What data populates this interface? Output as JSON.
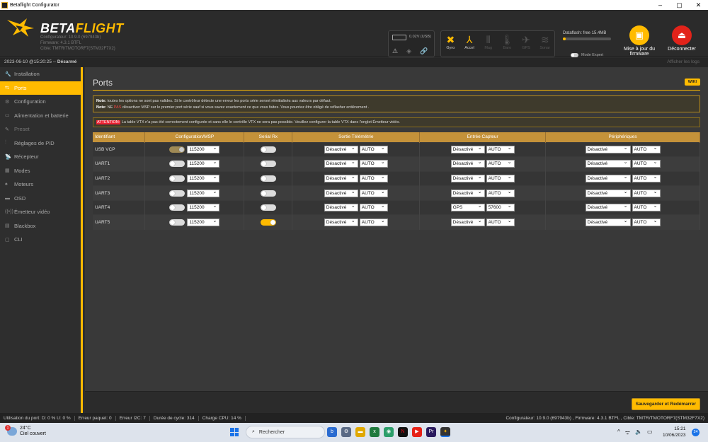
{
  "window": {
    "title": "Betaflight Configurator",
    "min": "–",
    "max": "▢",
    "close": "✕"
  },
  "header": {
    "brand_beta": "BETA",
    "brand_flight": "FLIGHT",
    "version_lines": [
      "Configurateur: 10.9.0 (697943b)",
      "Firmware: 4.3.1 BTFL",
      "Cible: TMTR/TMOTORF7(STM32F7X2)"
    ],
    "battery": "0.02V (USB)",
    "sensors": [
      {
        "icon": "gyro-icon",
        "glyph": "✖",
        "label": "Gyro",
        "active": true
      },
      {
        "icon": "accel-icon",
        "glyph": "⅄",
        "label": "Accel",
        "active": true
      },
      {
        "icon": "mag-icon",
        "glyph": "⫴",
        "label": "Mag",
        "active": false
      },
      {
        "icon": "baro-icon",
        "glyph": "🌡",
        "label": "Baro",
        "active": false
      },
      {
        "icon": "gps-icon",
        "glyph": "✈",
        "label": "GPS",
        "active": false
      },
      {
        "icon": "sonar-icon",
        "glyph": "≋",
        "label": "Sonar",
        "active": false
      }
    ],
    "dataflash_label": "Dataflash: free 15.4MB",
    "dataflash_used": 0.06,
    "expert_mode": "Mode Expert",
    "update_label": "Mise à jour du firmware",
    "disconnect_label": "Déconnecter"
  },
  "statusline": {
    "datetime": "2023-06-10 @15:20:25 -- ",
    "armed": "Désarmé",
    "logs": "Afficher les logs"
  },
  "sidebar": [
    {
      "icon": "wrench-icon",
      "glyph": "🔧",
      "label": "Installation",
      "active": false
    },
    {
      "icon": "ports-icon",
      "glyph": "⇆",
      "label": "Ports",
      "active": true
    },
    {
      "icon": "gear-icon",
      "glyph": "⚙",
      "label": "Configuration",
      "active": false
    },
    {
      "icon": "battery-icon",
      "glyph": "▭",
      "label": "Alimentation et batterie",
      "active": false
    },
    {
      "icon": "preset-icon",
      "glyph": "✎",
      "label": "Preset",
      "active": false,
      "dim": true
    },
    {
      "icon": "pid-icon",
      "glyph": "⫶",
      "label": "Réglages de PID",
      "active": false
    },
    {
      "icon": "receiver-icon",
      "glyph": "📡",
      "label": "Récepteur",
      "active": false
    },
    {
      "icon": "modes-icon",
      "glyph": "▦",
      "label": "Modes",
      "active": false
    },
    {
      "icon": "motors-icon",
      "glyph": "♠",
      "label": "Moteurs",
      "active": false
    },
    {
      "icon": "osd-icon",
      "glyph": "▬",
      "label": "OSD",
      "active": false
    },
    {
      "icon": "vtx-icon",
      "glyph": "((•))",
      "label": "Émetteur vidéo",
      "active": false
    },
    {
      "icon": "blackbox-icon",
      "glyph": "▤",
      "label": "Blackbox",
      "active": false
    },
    {
      "icon": "cli-icon",
      "glyph": "▢",
      "label": "CLI",
      "active": false
    }
  ],
  "content": {
    "title": "Ports",
    "wiki": "WIKI",
    "note1_b": "Note:",
    "note1": " toutes les options ne sont pas valides. Si le contrôleur détecte une erreur les ports série seront réinitialisés aux valeurs par défaut.",
    "note2_b": "Note:",
    "note2_a": " NE ",
    "note2_pas": "PAS",
    "note2_c": " désactiver MSP sur le premier port série sauf si vous savez exactement ce que vous faites. Vous pourriez être obligé de reflasher entièrement .",
    "warn_att": "ATTENTION:",
    "warn": " La table VTX n'a pas été correctement configurée et sans elle le contrôle VTX ne sera pas possible. Veuillez configurer la table VTX dans l'onglet Émetteur vidéo.",
    "headers": [
      "Identifiant",
      "Configuration/MSP",
      "Serial Rx",
      "Sortie Télémétrie",
      "Entrée Capteur",
      "Périphériques"
    ],
    "rows": [
      {
        "id": "USB VCP",
        "msp": "dis",
        "baud": "115200",
        "rx": false,
        "tel": "Désactivé",
        "tel_b": "AUTO",
        "sen": "Désactivé",
        "sen_b": "AUTO",
        "per": "Désactivé",
        "per_b": "AUTO"
      },
      {
        "id": "UART1",
        "msp": "off",
        "baud": "115200",
        "rx": false,
        "tel": "Désactivé",
        "tel_b": "AUTO",
        "sen": "Désactivé",
        "sen_b": "AUTO",
        "per": "Désactivé",
        "per_b": "AUTO"
      },
      {
        "id": "UART2",
        "msp": "off",
        "baud": "115200",
        "rx": false,
        "tel": "Désactivé",
        "tel_b": "AUTO",
        "sen": "Désactivé",
        "sen_b": "AUTO",
        "per": "Désactivé",
        "per_b": "AUTO"
      },
      {
        "id": "UART3",
        "msp": "off",
        "baud": "115200",
        "rx": false,
        "tel": "Désactivé",
        "tel_b": "AUTO",
        "sen": "Désactivé",
        "sen_b": "AUTO",
        "per": "Désactivé",
        "per_b": "AUTO"
      },
      {
        "id": "UART4",
        "msp": "off",
        "baud": "115200",
        "rx": false,
        "tel": "Désactivé",
        "tel_b": "AUTO",
        "sen": "GPS",
        "sen_b": "57600",
        "per": "Désactivé",
        "per_b": "AUTO"
      },
      {
        "id": "UART5",
        "msp": "off",
        "baud": "115200",
        "rx": true,
        "tel": "Désactivé",
        "tel_b": "AUTO",
        "sen": "Désactivé",
        "sen_b": "AUTO",
        "per": "Désactivé",
        "per_b": "AUTO"
      }
    ],
    "save": "Sauvegarder et Redémarrer"
  },
  "statusbar": {
    "items": [
      "Utilisation du port: D: 0 % U: 0 %",
      "Erreur paquet: 0",
      "Erreur I2C: 7",
      "Durée de cycle: 314",
      "Charge CPU: 14 %"
    ],
    "right": "Configurateur: 10.9.0 (697943b) , Firmware: 4.3.1 BTFL , Cible: TMTR/TMOTORF7(STM32F7X2)"
  },
  "taskbar": {
    "temp": "24°C",
    "weather": "Ciel couvert",
    "weather_badge": "1",
    "search": "Rechercher",
    "time": "15:21",
    "date": "10/06/2023",
    "notif": "24"
  },
  "colors": {
    "accent": "#ffbb00"
  }
}
